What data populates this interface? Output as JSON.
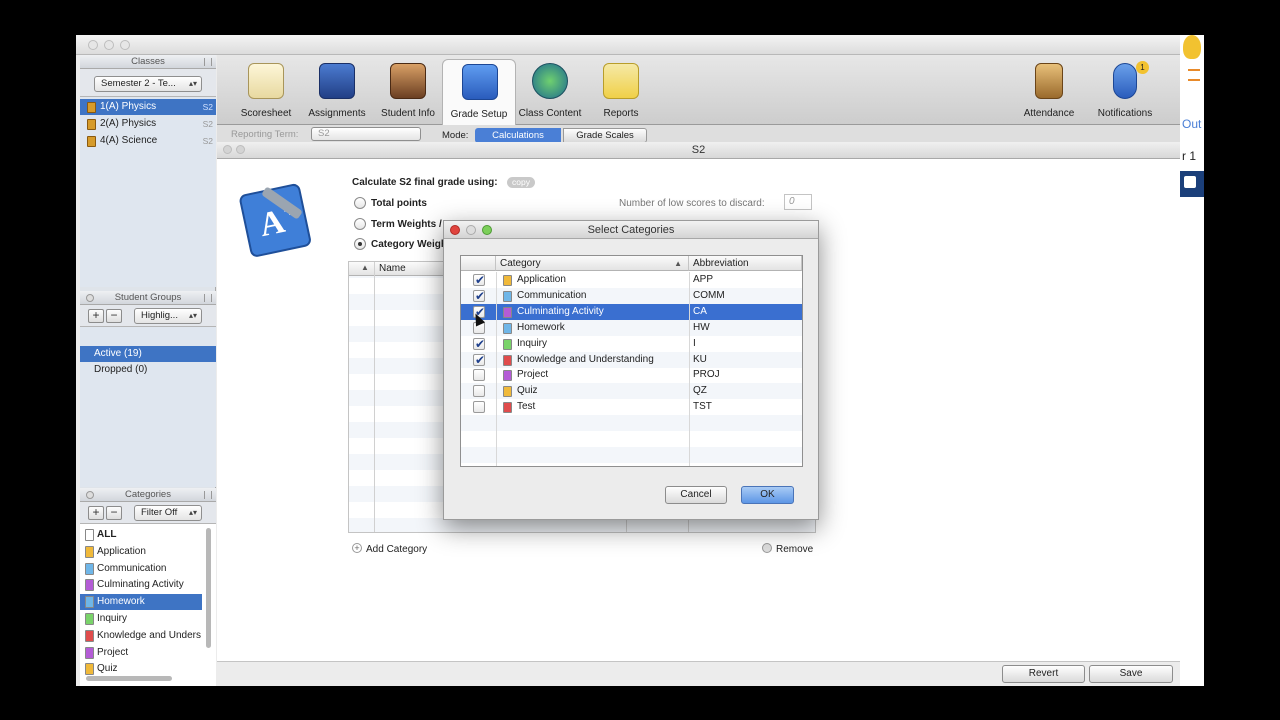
{
  "sidebar": {
    "classes_header": "Classes",
    "term_select": "Semester 2 - Te...",
    "classes": [
      {
        "label": "1(A) Physics",
        "sub": "S2",
        "selected": true
      },
      {
        "label": "2(A) Physics",
        "sub": "S2",
        "selected": false
      },
      {
        "label": "4(A) Science",
        "sub": "S2",
        "selected": false
      }
    ],
    "groups_header": "Student Groups",
    "groups_filter": "Highlig...",
    "groups": [
      {
        "label": "Active (19)",
        "selected": true
      },
      {
        "label": "Dropped (0)",
        "selected": false
      }
    ],
    "categories_header": "Categories",
    "categories_filter": "Filter Off",
    "categories": [
      {
        "label": "ALL",
        "color": "#ffffff",
        "bold": true,
        "selected": false
      },
      {
        "label": "Application",
        "color": "#f0b93a",
        "selected": false
      },
      {
        "label": "Communication",
        "color": "#6fb6e8",
        "selected": false
      },
      {
        "label": "Culminating Activity",
        "color": "#b45cd6",
        "selected": false
      },
      {
        "label": "Homework",
        "color": "#6fb6e8",
        "selected": true
      },
      {
        "label": "Inquiry",
        "color": "#7ad36a",
        "selected": false
      },
      {
        "label": "Knowledge and Unders",
        "color": "#e04c4c",
        "selected": false
      },
      {
        "label": "Project",
        "color": "#b45cd6",
        "selected": false
      },
      {
        "label": "Quiz",
        "color": "#f0b93a",
        "selected": false
      }
    ]
  },
  "toolbar": {
    "items": [
      {
        "label": "Scoresheet",
        "icon": "scoresheet-icon",
        "selected": false
      },
      {
        "label": "Assignments",
        "icon": "assignments-icon",
        "selected": false
      },
      {
        "label": "Student Info",
        "icon": "student-info-icon",
        "selected": false
      },
      {
        "label": "Grade Setup",
        "icon": "grade-setup-icon",
        "selected": true
      },
      {
        "label": "Class Content",
        "icon": "class-content-icon",
        "selected": false
      },
      {
        "label": "Reports",
        "icon": "reports-icon",
        "selected": false
      }
    ],
    "right_items": [
      {
        "label": "Attendance",
        "icon": "attendance-icon"
      },
      {
        "label": "Notifications",
        "icon": "notifications-icon",
        "badge": "1"
      }
    ]
  },
  "subbar": {
    "reporting_term_label": "Reporting Term:",
    "reporting_term_value": "S2",
    "mode_label": "Mode:",
    "tab_calculations": "Calculations",
    "tab_grade_scales": "Grade Scales"
  },
  "right_edge": {
    "logout": "Out",
    "term": "r 1"
  },
  "doc": {
    "title": "S2",
    "calc_label": "Calculate S2 final grade using:",
    "copy_label": "copy",
    "opt_total": "Total points",
    "opt_term": "Term Weights /",
    "opt_category": "Category Weigh",
    "low_scores_label": "Number of low scores to discard:",
    "low_scores_value": "0",
    "table_name_header": "Name",
    "add_category": "Add Category",
    "remove": "Remove",
    "revert": "Revert",
    "save": "Save"
  },
  "dialog": {
    "title": "Select Categories",
    "col_category": "Category",
    "col_abbreviation": "Abbreviation",
    "rows": [
      {
        "name": "Application",
        "abbr": "APP",
        "checked": true,
        "color": "#f0b93a",
        "selected": false
      },
      {
        "name": "Communication",
        "abbr": "COMM",
        "checked": true,
        "color": "#6fb6e8",
        "selected": false
      },
      {
        "name": "Culminating Activity",
        "abbr": "CA",
        "checked": true,
        "color": "#b45cd6",
        "selected": true
      },
      {
        "name": "Homework",
        "abbr": "HW",
        "checked": false,
        "color": "#6fb6e8",
        "selected": false
      },
      {
        "name": "Inquiry",
        "abbr": "I",
        "checked": true,
        "color": "#7ad36a",
        "selected": false
      },
      {
        "name": "Knowledge and Understanding",
        "abbr": "KU",
        "checked": true,
        "color": "#e04c4c",
        "selected": false
      },
      {
        "name": "Project",
        "abbr": "PROJ",
        "checked": false,
        "color": "#b45cd6",
        "selected": false
      },
      {
        "name": "Quiz",
        "abbr": "QZ",
        "checked": false,
        "color": "#f0b93a",
        "selected": false
      },
      {
        "name": "Test",
        "abbr": "TST",
        "checked": false,
        "color": "#e04c4c",
        "selected": false
      }
    ],
    "cancel": "Cancel",
    "ok": "OK"
  }
}
